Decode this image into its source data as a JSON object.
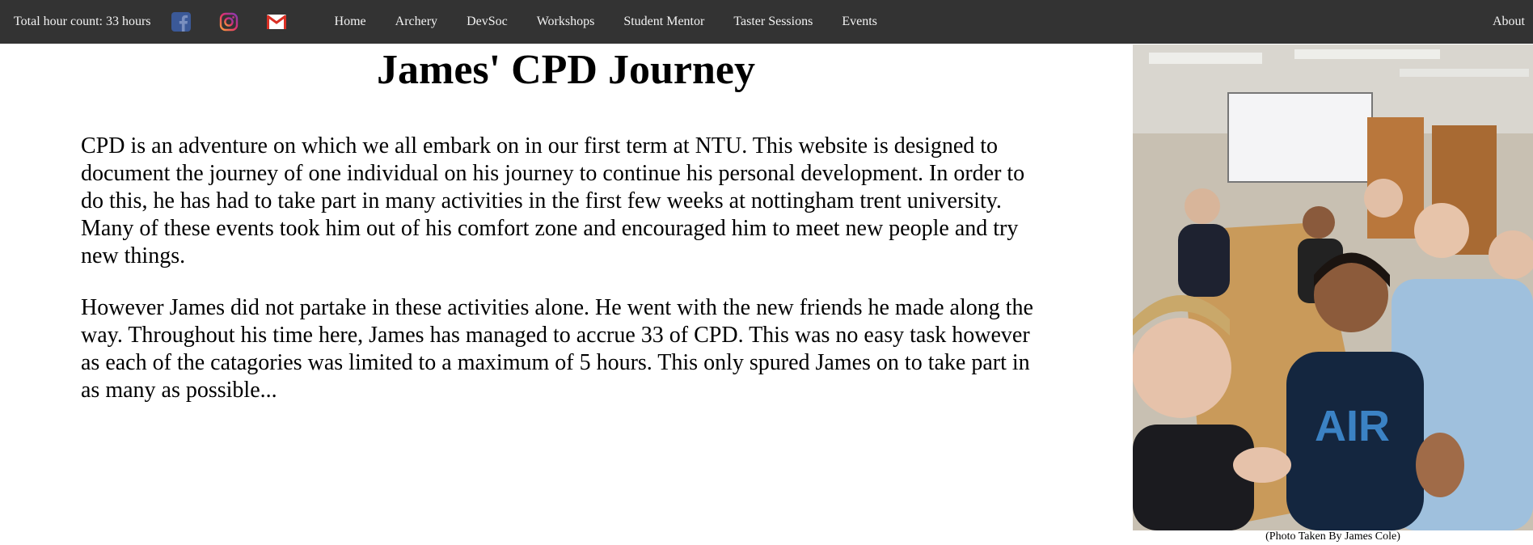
{
  "nav": {
    "hour_count": "Total hour count: 33 hours",
    "social_icons": [
      "facebook-icon",
      "instagram-icon",
      "gmail-icon"
    ],
    "links": [
      "Home",
      "Archery",
      "DevSoc",
      "Workshops",
      "Student Mentor",
      "Taster Sessions",
      "Events"
    ],
    "about": "About"
  },
  "colors": {
    "nav_background": "#333333",
    "nav_text": "#f2f2f2",
    "facebook": "#3b5998",
    "gmail_red": "#d93025"
  },
  "page": {
    "title": "James' CPD Journey",
    "paragraphs": [
      "CPD is an adventure on which we all embark on in our first term at NTU. This website is designed to document the journey of one individual on his journey to continue his personal development. In order to do this, he has had to take part in many activities in the first few weeks at nottingham trent university. Many of these events took him out of his comfort zone and encouraged him to meet new people and try new things.",
      "However James did not partake in these activities alone. He went with the new friends he made along the way. Throughout his time here, James has managed to accrue 33 of CPD. This was no easy task however as each of the catagories was limited to a maximum of 5 hours. This only spured James on to take part in as many as possible..."
    ]
  },
  "photo": {
    "caption": "(Photo Taken By James Cole)"
  }
}
